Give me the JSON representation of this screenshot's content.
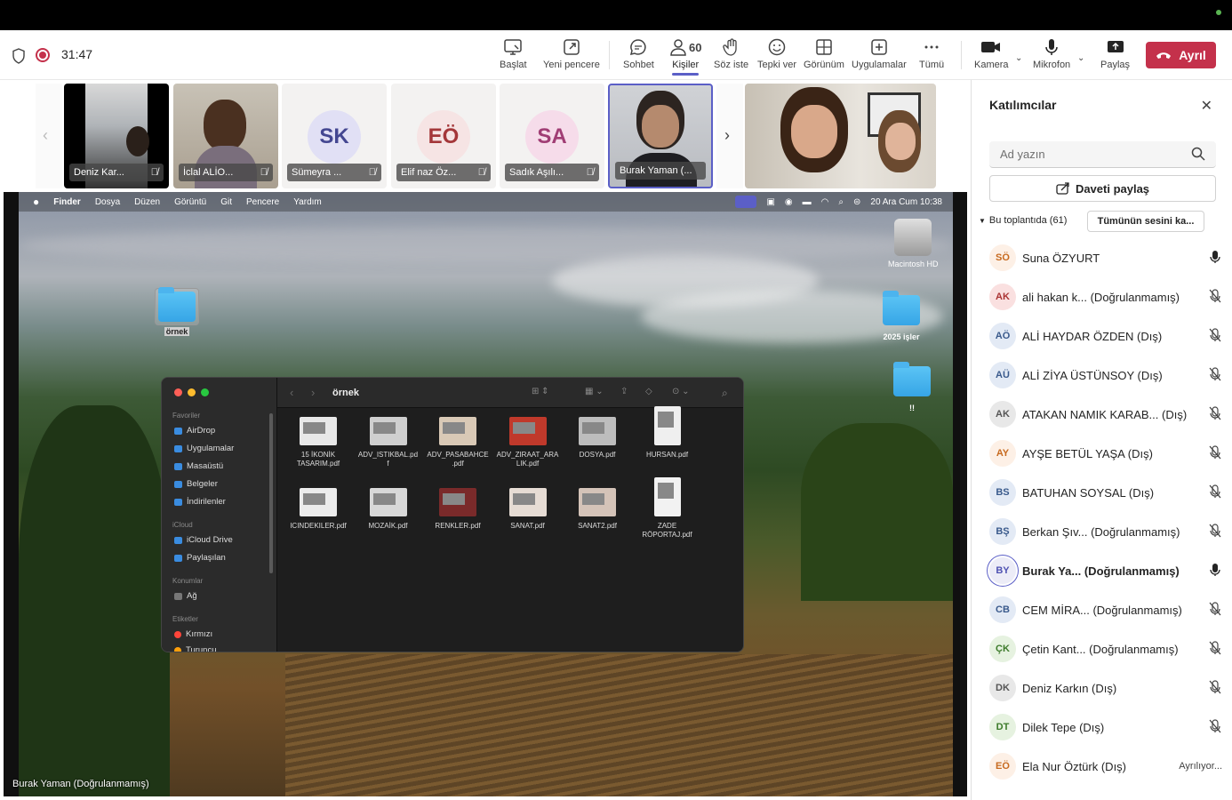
{
  "toolbar": {
    "timer": "31:47",
    "buttons": [
      {
        "label": "Başlat",
        "icon": "share-screen-icon"
      },
      {
        "label": "Yeni pencere",
        "icon": "new-window-icon"
      },
      {
        "label": "Sohbet",
        "icon": "chat-icon"
      },
      {
        "label": "Kişiler",
        "icon": "people-icon",
        "count": "60"
      },
      {
        "label": "Söz iste",
        "icon": "raise-hand-icon"
      },
      {
        "label": "Tepki ver",
        "icon": "emoji-icon"
      },
      {
        "label": "Görünüm",
        "icon": "view-grid-icon"
      },
      {
        "label": "Uygulamalar",
        "icon": "apps-add-icon"
      },
      {
        "label": "Tümü",
        "icon": "more-icon"
      },
      {
        "label": "Kamera",
        "icon": "camera-icon"
      },
      {
        "label": "Mikrofon",
        "icon": "microphone-icon"
      },
      {
        "label": "Paylaş",
        "icon": "share-icon"
      }
    ],
    "leave_label": "Ayrıl",
    "accent": "#5b5fc7",
    "leave_color": "#c4314b"
  },
  "video_strip": [
    {
      "name": "Deniz Kar...",
      "type": "video"
    },
    {
      "name": "İclal ALİO...",
      "type": "video"
    },
    {
      "name": "Sümeyra ...",
      "type": "avatar",
      "initials": "SK"
    },
    {
      "name": "Elif naz Öz...",
      "type": "avatar",
      "initials": "EÖ"
    },
    {
      "name": "Sadık Aşılı...",
      "type": "avatar",
      "initials": "SA"
    },
    {
      "name": "Burak Yaman (...",
      "type": "video",
      "active": true
    }
  ],
  "shared_screen": {
    "presenter": "Burak Yaman (Doğrulanmamış)",
    "menubar": {
      "app": "Finder",
      "items": [
        "Dosya",
        "Düzen",
        "Görüntü",
        "Git",
        "Pencere",
        "Yardım"
      ],
      "datetime": "20 Ara Cum  10:38"
    },
    "desktop_icons": [
      {
        "label": "örnek"
      },
      {
        "label": "Macintosh HD"
      },
      {
        "label": "2025 işler"
      },
      {
        "label": "!!"
      }
    ],
    "finder": {
      "title": "örnek",
      "sidebar": {
        "favorites_heading": "Favoriler",
        "favorites": [
          "AirDrop",
          "Uygulamalar",
          "Masaüstü",
          "Belgeler",
          "İndirilenler"
        ],
        "icloud_heading": "iCloud",
        "icloud": [
          "iCloud Drive",
          "Paylaşılan"
        ],
        "locations_heading": "Konumlar",
        "locations": [
          "Ağ"
        ],
        "tags_heading": "Etiketler",
        "tags": [
          "Kırmızı",
          "Turuncu"
        ]
      },
      "files": [
        {
          "line1": "15 İKONİK",
          "line2": "TASARIM.pdf"
        },
        {
          "line1": "ADV_ISTIKBAL.pd",
          "line2": "f"
        },
        {
          "line1": "ADV_PASABAHCE",
          "line2": ".pdf"
        },
        {
          "line1": "ADV_ZIRAAT_ARA",
          "line2": "LIK.pdf"
        },
        {
          "line1": "DOSYA.pdf",
          "line2": ""
        },
        {
          "line1": "HURSAN.pdf",
          "line2": ""
        },
        {
          "line1": "ICINDEKILER.pdf",
          "line2": ""
        },
        {
          "line1": "MOZAİK.pdf",
          "line2": ""
        },
        {
          "line1": "RENKLER.pdf",
          "line2": ""
        },
        {
          "line1": "SANAT.pdf",
          "line2": ""
        },
        {
          "line1": "SANAT2.pdf",
          "line2": ""
        },
        {
          "line1": "ZADE",
          "line2": "RÖPORTAJ.pdf"
        }
      ]
    }
  },
  "participants_panel": {
    "title": "Katılımcılar",
    "search_placeholder": "Ad yazın",
    "invite_label": "Daveti paylaş",
    "in_meeting": "Bu toplantıda (61)",
    "mute_all_label": "Tümünün sesini ka...",
    "people": [
      {
        "initials": "SÖ",
        "name": "Suna ÖZYURT",
        "mic": "on",
        "bg": "#fdf0e6",
        "fg": "#c76a1f"
      },
      {
        "initials": "AK",
        "name": "ali hakan k...  (Doğrulanmamış)",
        "mic": "off",
        "bg": "#fae0e0",
        "fg": "#a33"
      },
      {
        "initials": "AÖ",
        "name": "ALİ HAYDAR ÖZDEN (Dış)",
        "mic": "off",
        "bg": "#e3eaf5",
        "fg": "#3a5a8c"
      },
      {
        "initials": "AÜ",
        "name": "ALİ ZİYA ÜSTÜNSOY (Dış)",
        "mic": "off",
        "bg": "#e3eaf5",
        "fg": "#3a5a8c"
      },
      {
        "initials": "AK",
        "name": "ATAKAN NAMIK KARAB...  (Dış)",
        "mic": "off",
        "bg": "#e8e8e8",
        "fg": "#555"
      },
      {
        "initials": "AY",
        "name": "AYŞE BETÜL YAŞA (Dış)",
        "mic": "off",
        "bg": "#fdf0e6",
        "fg": "#c76a1f"
      },
      {
        "initials": "BS",
        "name": "BATUHAN SOYSAL (Dış)",
        "mic": "off",
        "bg": "#e3eaf5",
        "fg": "#3a5a8c"
      },
      {
        "initials": "BŞ",
        "name": "Berkan Şıv...  (Doğrulanmamış)",
        "mic": "off",
        "bg": "#e3eaf5",
        "fg": "#3a5a8c"
      },
      {
        "initials": "BY",
        "name": "Burak Ya...  (Doğrulanmamış)",
        "mic": "on",
        "bg": "#ececf7",
        "fg": "#4f52b2",
        "bold": true
      },
      {
        "initials": "CB",
        "name": "CEM MİRA...  (Doğrulanmamış)",
        "mic": "off",
        "bg": "#e3eaf5",
        "fg": "#3a5a8c"
      },
      {
        "initials": "ÇK",
        "name": "Çetin Kant...  (Doğrulanmamış)",
        "mic": "off",
        "bg": "#e6f2e0",
        "fg": "#3c7a2a"
      },
      {
        "initials": "DK",
        "name": "Deniz Karkın (Dış)",
        "mic": "off",
        "bg": "#e8e8e8",
        "fg": "#555"
      },
      {
        "initials": "DT",
        "name": "Dilek Tepe (Dış)",
        "mic": "off",
        "bg": "#e6f2e0",
        "fg": "#3c7a2a"
      },
      {
        "initials": "EÖ",
        "name": "Ela Nur Öztürk (Dış)",
        "mic": "leaving",
        "status": "Ayrılıyor...",
        "bg": "#fdf0e6",
        "fg": "#c76a1f"
      }
    ]
  }
}
